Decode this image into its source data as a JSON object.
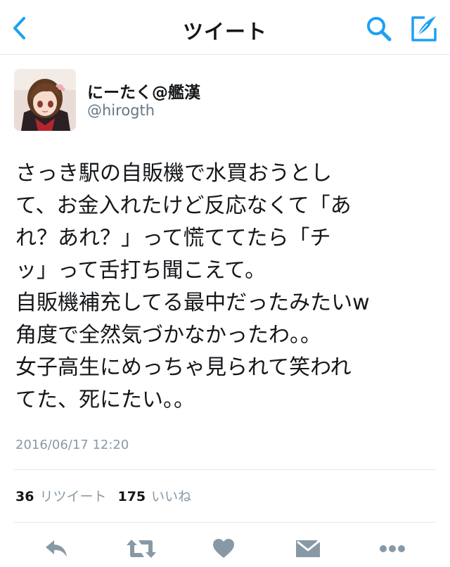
{
  "header": {
    "title": "ツイート",
    "back_icon": "chevron-left-icon",
    "search_icon": "search-icon",
    "compose_icon": "compose-icon"
  },
  "colors": {
    "accent": "#1da1f2",
    "text": "#14171a",
    "secondary": "#8899a6",
    "divider": "#e1e8ed",
    "action_icon": "#8899a6"
  },
  "tweet": {
    "author": {
      "display_name": "にーたく@艦漢",
      "handle": "@hirogth"
    },
    "text_lines": [
      "さっき駅の自販機で水買おうとし",
      "て、お金入れたけど反応なくて「あ",
      "れ？あれ？」って慌ててたら「チ",
      "ッ」って舌打ち聞こえて。",
      "自販機補充してる最中だったみたいw",
      "角度で全然気づかなかったわ。。",
      "女子高生にめっちゃ見られて笑われ",
      "てた、死にたい。。"
    ],
    "timestamp": "2016/06/17 12:20",
    "retweets": {
      "count": "36",
      "label": "リツイート"
    },
    "likes": {
      "count": "175",
      "label": "いいね"
    }
  },
  "actions": [
    {
      "icon": "reply-icon"
    },
    {
      "icon": "retweet-icon"
    },
    {
      "icon": "heart-icon"
    },
    {
      "icon": "direct-message-icon"
    },
    {
      "icon": "more-icon"
    }
  ]
}
